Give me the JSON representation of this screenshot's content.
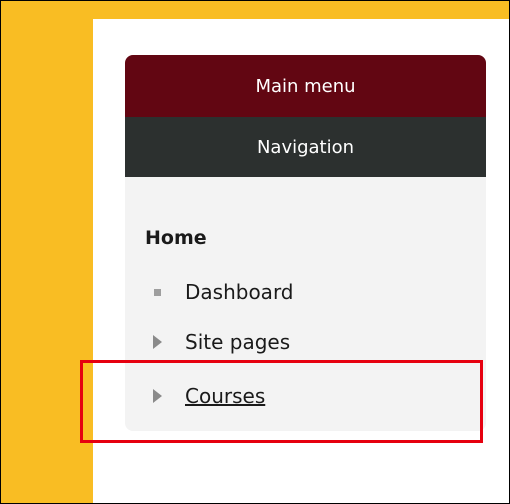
{
  "block": {
    "main_menu_label": "Main menu",
    "navigation_label": "Navigation",
    "home_label": "Home",
    "items": [
      {
        "label": "Dashboard",
        "icon": "square-bullet-icon"
      },
      {
        "label": "Site pages",
        "icon": "triangle-right-icon"
      },
      {
        "label": "Courses",
        "icon": "triangle-right-icon"
      }
    ]
  },
  "colors": {
    "page_background": "#f9bd23",
    "main_menu_bg": "#620612",
    "navigation_bg": "#2c302f",
    "block_bg": "#f3f3f3",
    "highlight": "#e6000f"
  }
}
